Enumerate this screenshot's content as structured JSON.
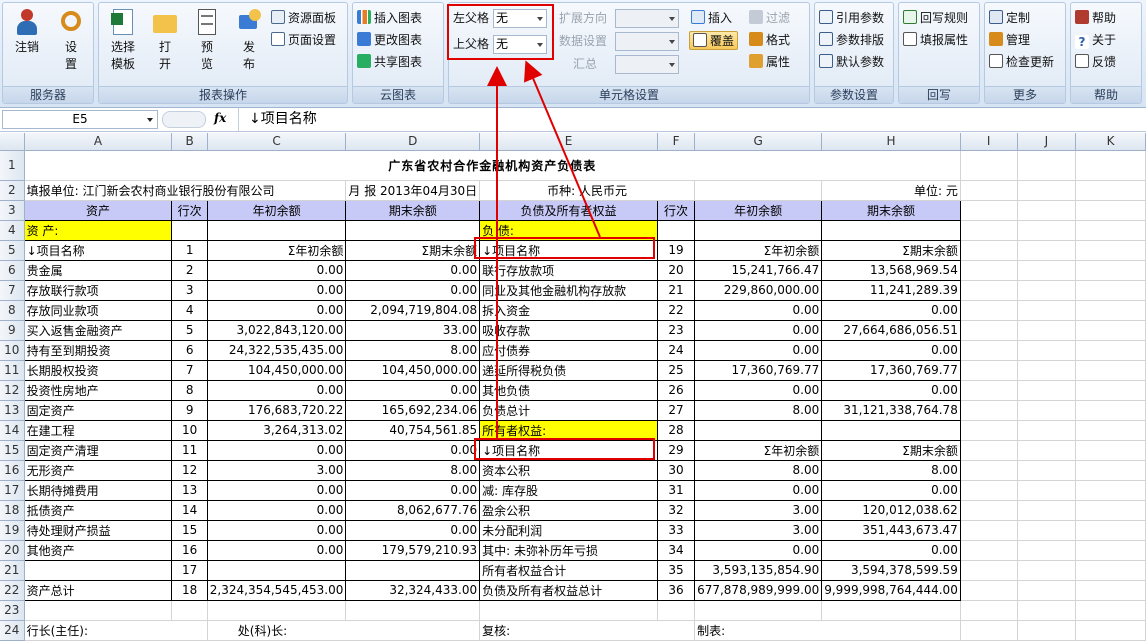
{
  "ribbon": {
    "groups": {
      "server": "服务器",
      "report": "报表操作",
      "cloud": "云图表",
      "cell": "单元格设置",
      "param": "参数设置",
      "writeback": "回写",
      "more": "更多",
      "help": "帮助"
    },
    "login": "注销",
    "settings": [
      "设",
      "置"
    ],
    "select_tpl": [
      "选择",
      "模板"
    ],
    "open": [
      "打",
      "开"
    ],
    "preview": [
      "预",
      "览"
    ],
    "publish": [
      "发",
      "布"
    ],
    "resource_panel": "资源面板",
    "page_setup": "页面设置",
    "insert_chart": "插入图表",
    "change_chart": "更改图表",
    "share_chart": "共享图表",
    "left_parent_label": "左父格",
    "left_parent_value": "无",
    "upper_parent_label": "上父格",
    "upper_parent_value": "无",
    "expand_dir": "扩展方向",
    "data_setting": "数据设置",
    "summary": "汇总",
    "insert": "插入",
    "filter": "过滤",
    "cover": "覆盖",
    "format": "格式",
    "attr": "属性",
    "ref_param": "引用参数",
    "param_layout": "参数排版",
    "default_param": "默认参数",
    "writeback_rule": "回写规则",
    "fill_attr": "填报属性",
    "custom": "定制",
    "manage": "管理",
    "check_update": "检查更新",
    "help": "帮助",
    "about": "关于",
    "feedback": "反馈"
  },
  "formula_bar": {
    "name_box": "E5",
    "fx": "fx",
    "content": "↓项目名称"
  },
  "columns": [
    "A",
    "B",
    "C",
    "D",
    "E",
    "F",
    "G",
    "H",
    "I",
    "J",
    "K"
  ],
  "rows": [
    "1",
    "2",
    "3",
    "4",
    "5",
    "6",
    "7",
    "8",
    "9",
    "10",
    "11",
    "12",
    "13",
    "14",
    "15",
    "16",
    "17",
    "18",
    "19",
    "20",
    "21",
    "22",
    "23",
    "24"
  ],
  "sheet": {
    "title": "广东省农村合作金融机构资产负债表",
    "fill_unit": "填报单位: 江门新会农村商业银行股份有限公司",
    "period": "月 报  2013年04月30日",
    "currency": "币种: 人民币元",
    "unit": "单位: 元",
    "h_assets": "资产",
    "h_line": "行次",
    "h_begin": "年初余额",
    "h_end": "期末余额",
    "h_liab": "负债及所有者权益",
    "sec_assets": "资 产:",
    "sec_liab": "负 债:",
    "sec_equity": "所有者权益:",
    "item": "↓项目名称",
    "sum_begin": "Σ年初余额",
    "sum_end": "Σ期末余额",
    "r5": {
      "n": "1",
      "n2": "19"
    },
    "left": [
      {
        "name": "贵金属",
        "n": "2",
        "b": "0.00",
        "e": "0.00"
      },
      {
        "name": "存放联行款项",
        "n": "3",
        "b": "0.00",
        "e": "0.00"
      },
      {
        "name": "存放同业款项",
        "n": "4",
        "b": "0.00",
        "e": "2,094,719,804.08"
      },
      {
        "name": "买入返售金融资产",
        "n": "5",
        "b": "3,022,843,120.00",
        "e": "33.00"
      },
      {
        "name": "持有至到期投资",
        "n": "6",
        "b": "24,322,535,435.00",
        "e": "8.00"
      },
      {
        "name": "长期股权投资",
        "n": "7",
        "b": "104,450,000.00",
        "e": "104,450,000.00"
      },
      {
        "name": "投资性房地产",
        "n": "8",
        "b": "0.00",
        "e": "0.00"
      },
      {
        "name": "固定资产",
        "n": "9",
        "b": "176,683,720.22",
        "e": "165,692,234.06"
      },
      {
        "name": "在建工程",
        "n": "10",
        "b": "3,264,313.02",
        "e": "40,754,561.85"
      },
      {
        "name": "固定资产清理",
        "n": "11",
        "b": "0.00",
        "e": "0.00"
      },
      {
        "name": "无形资产",
        "n": "12",
        "b": "3.00",
        "e": "8.00"
      },
      {
        "name": "长期待摊费用",
        "n": "13",
        "b": "0.00",
        "e": "0.00"
      },
      {
        "name": "抵债资产",
        "n": "14",
        "b": "0.00",
        "e": "8,062,677.76"
      },
      {
        "name": "待处理财产损益",
        "n": "15",
        "b": "0.00",
        "e": "0.00"
      },
      {
        "name": "其他资产",
        "n": "16",
        "b": "0.00",
        "e": "179,579,210.93"
      },
      {
        "name": "",
        "n": "17",
        "b": "",
        "e": ""
      },
      {
        "name": "资产总计",
        "n": "18",
        "b": "2,324,354,545,453.00",
        "e": "32,324,433.00"
      }
    ],
    "right": [
      {
        "name": "联行存放款项",
        "n": "20",
        "b": "15,241,766.47",
        "e": "13,568,969.54"
      },
      {
        "name": "同业及其他金融机构存放款",
        "n": "21",
        "b": "229,860,000.00",
        "e": "11,241,289.39"
      },
      {
        "name": "拆入资金",
        "n": "22",
        "b": "0.00",
        "e": "0.00"
      },
      {
        "name": "吸收存款",
        "n": "23",
        "b": "0.00",
        "e": "27,664,686,056.51"
      },
      {
        "name": "应付债券",
        "n": "24",
        "b": "0.00",
        "e": "0.00"
      },
      {
        "name": "递延所得税负债",
        "n": "25",
        "b": "17,360,769.77",
        "e": "17,360,769.77"
      },
      {
        "name": "其他负债",
        "n": "26",
        "b": "0.00",
        "e": "0.00"
      },
      {
        "name": "负债总计",
        "n": "27",
        "b": "8.00",
        "e": "31,121,338,764.78"
      },
      {
        "name": "所有者权益:",
        "n": "28",
        "b": "",
        "e": ""
      },
      {
        "name": "↓项目名称",
        "n": "29",
        "b": "Σ年初余额",
        "e": "Σ期末余额"
      },
      {
        "name": "资本公积",
        "n": "30",
        "b": "8.00",
        "e": "8.00"
      },
      {
        "name": "减: 库存股",
        "n": "31",
        "b": "0.00",
        "e": "0.00"
      },
      {
        "name": "盈余公积",
        "n": "32",
        "b": "3.00",
        "e": "120,012,038.62"
      },
      {
        "name": "未分配利润",
        "n": "33",
        "b": "3.00",
        "e": "351,443,673.47"
      },
      {
        "name": "其中: 未弥补历年亏损",
        "n": "34",
        "b": "0.00",
        "e": "0.00"
      },
      {
        "name": "所有者权益合计",
        "n": "35",
        "b": "3,593,135,854.90",
        "e": "3,594,378,599.59"
      },
      {
        "name": "负债及所有者权益总计",
        "n": "36",
        "b": "677,878,989,999.00",
        "e": "9,999,998,764,444.00"
      }
    ],
    "footer": {
      "president": "行长(主任):",
      "section_chief": "处(科)长:",
      "reviewer": "复核:",
      "preparer": "制表:"
    }
  }
}
